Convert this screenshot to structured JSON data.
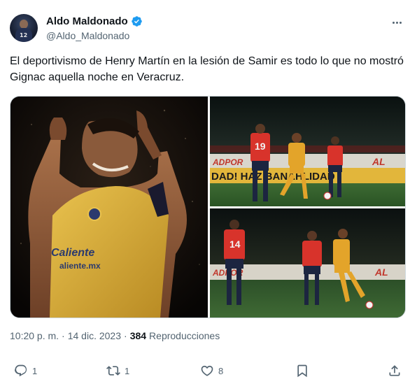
{
  "author": {
    "display_name": "Aldo Maldonado",
    "handle": "@Aldo_Maldonado",
    "avatar_jersey_number": "12"
  },
  "tweet": {
    "text": "El deportivismo de Henry Martín en la lesión de Samir es todo lo que no mostró Gignac aquella noche en Veracruz."
  },
  "media": {
    "photo_left": {
      "jersey_brand": "Caliente.mx"
    },
    "photo_top_right": {
      "ad_board_top": "ADPOR",
      "ad_board_top_right": "AL",
      "banner": "DAD! HAZ BANAHLIDAD",
      "player_number": "19"
    },
    "photo_bottom_right": {
      "ad_board": "ADPOR",
      "ad_board_right": "AL",
      "player_number": "14"
    }
  },
  "meta": {
    "time": "10:20 p. m.",
    "separator": "·",
    "date": "14 dic. 2023",
    "views_count": "384",
    "views_label": "Reproducciones"
  },
  "actions": {
    "replies": "1",
    "retweets": "1",
    "likes": "8"
  },
  "colors": {
    "verified": "#1d9bf0",
    "secondary_text": "#536471",
    "primary_text": "#0f1419",
    "veracruz_red": "#d8332b",
    "tigres_gold": "#e3a42a",
    "america_yellow": "#d7ad3c"
  }
}
